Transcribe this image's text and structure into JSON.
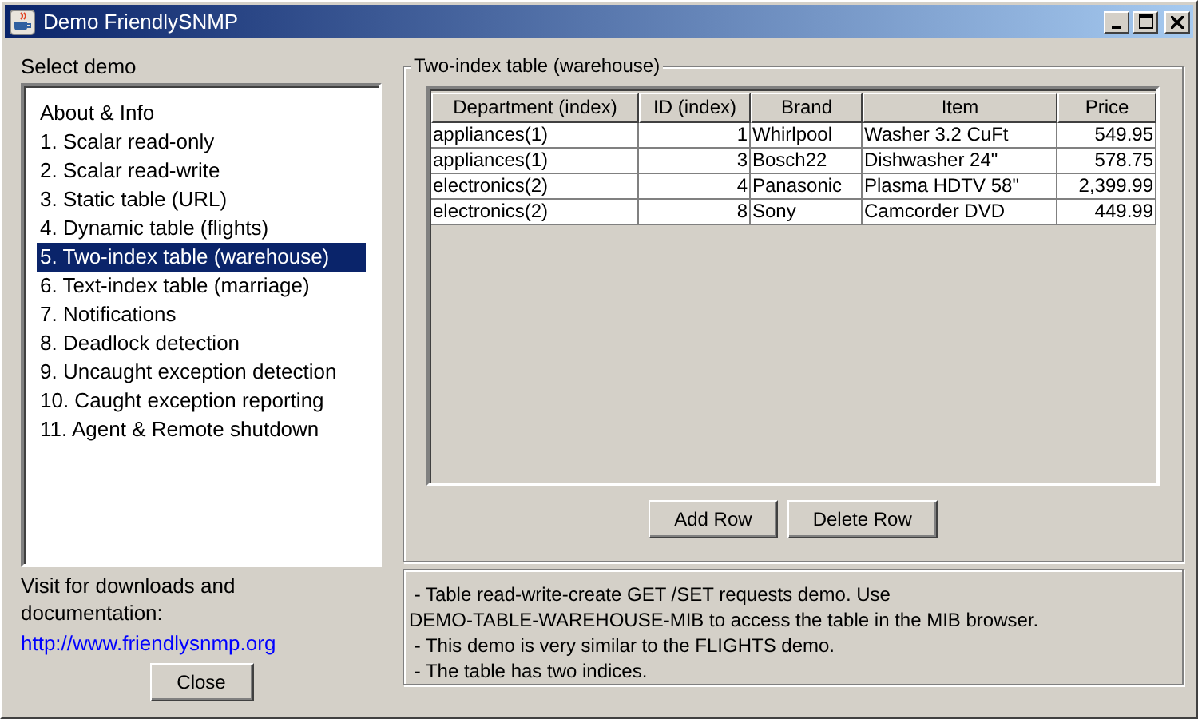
{
  "window": {
    "title": "Demo FriendlySNMP"
  },
  "sidebar": {
    "label": "Select demo",
    "items": [
      {
        "label": "About & Info",
        "selected": false
      },
      {
        "label": "1. Scalar read-only",
        "selected": false
      },
      {
        "label": "2. Scalar read-write",
        "selected": false
      },
      {
        "label": "3. Static table (URL)",
        "selected": false
      },
      {
        "label": "4. Dynamic table (flights)",
        "selected": false
      },
      {
        "label": "5. Two-index table (warehouse)",
        "selected": true
      },
      {
        "label": "6. Text-index table (marriage)",
        "selected": false
      },
      {
        "label": "7. Notifications",
        "selected": false
      },
      {
        "label": "8. Deadlock detection",
        "selected": false
      },
      {
        "label": "9. Uncaught exception detection",
        "selected": false
      },
      {
        "label": "10. Caught exception reporting",
        "selected": false
      },
      {
        "label": "11. Agent & Remote shutdown",
        "selected": false
      }
    ],
    "visit_text": "Visit for downloads and documentation:",
    "link": "http://www.friendlysnmp.org",
    "close_button": "Close"
  },
  "panel": {
    "title": "Two-index table (warehouse)",
    "table": {
      "columns": [
        {
          "label": "Department (index)",
          "kind": "text"
        },
        {
          "label": "ID (index)",
          "kind": "number"
        },
        {
          "label": "Brand",
          "kind": "text"
        },
        {
          "label": "Item",
          "kind": "text"
        },
        {
          "label": "Price",
          "kind": "number"
        }
      ],
      "rows": [
        [
          "appliances(1)",
          "1",
          "Whirlpool",
          "Washer 3.2 CuFt",
          "549.95"
        ],
        [
          "appliances(1)",
          "3",
          "Bosch22",
          "Dishwasher 24\"",
          "578.75"
        ],
        [
          "electronics(2)",
          "4",
          "Panasonic",
          "Plasma HDTV 58\"",
          "2,399.99"
        ],
        [
          "electronics(2)",
          "8",
          "Sony",
          "Camcorder DVD",
          "449.99"
        ]
      ]
    },
    "buttons": [
      "Add Row",
      "Delete Row"
    ]
  },
  "description": [
    " - Table read-write-create GET /SET requests demo. Use",
    "DEMO-TABLE-WAREHOUSE-MIB to access the table in the MIB browser.",
    " - This demo is very similar to the FLIGHTS demo.",
    " - The table has two indices."
  ]
}
